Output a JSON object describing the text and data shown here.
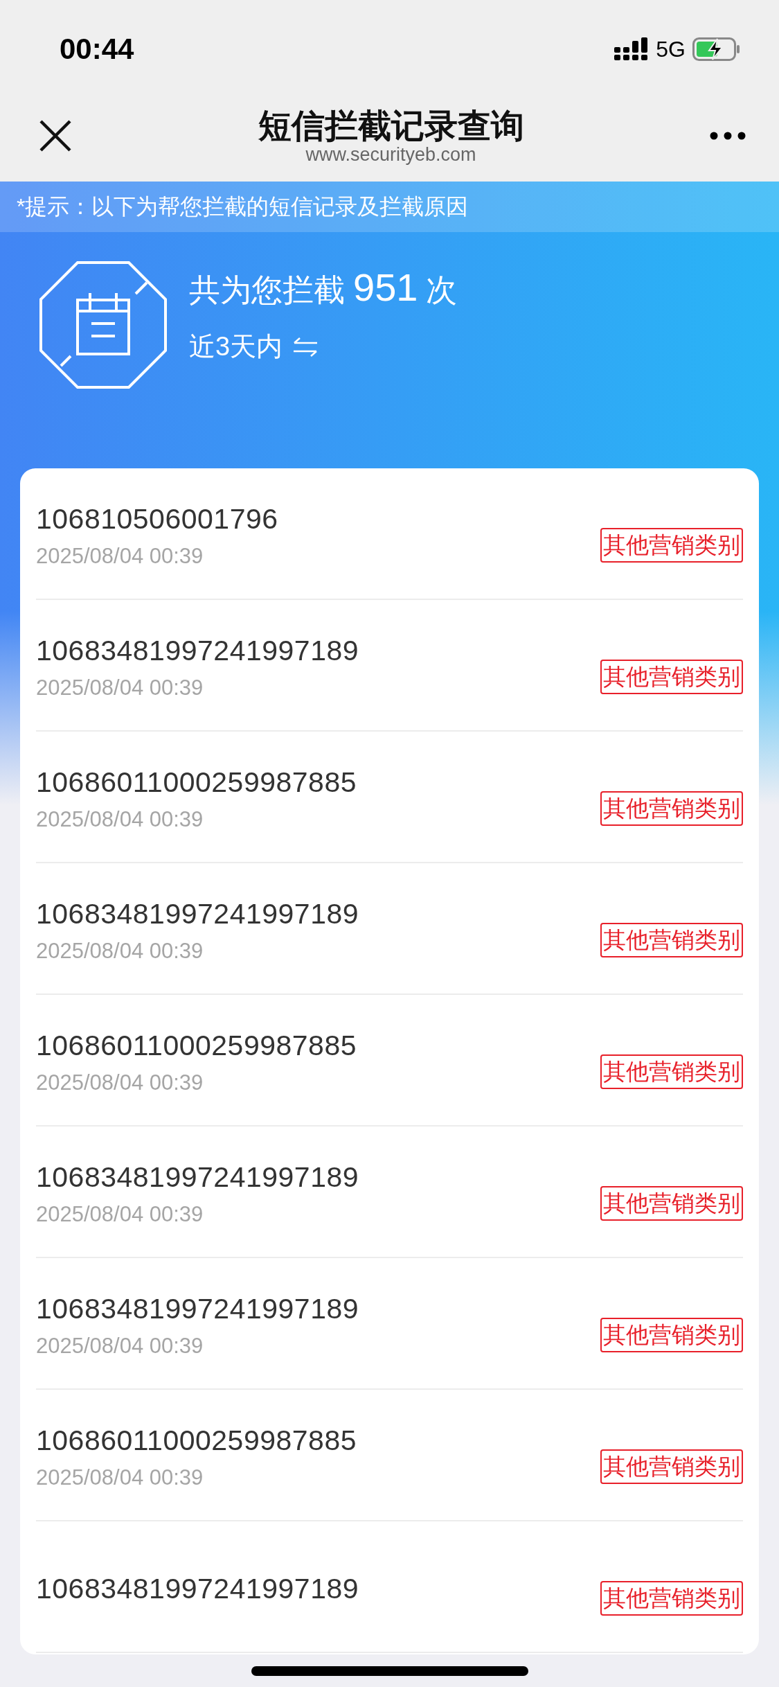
{
  "status_bar": {
    "time": "00:44",
    "network": "5G"
  },
  "nav": {
    "title": "短信拦截记录查询",
    "subtitle": "www.securityeb.com"
  },
  "hint": "*提示：以下为帮您拦截的短信记录及拦截原因",
  "summary": {
    "prefix": "共为您拦截",
    "count": "951",
    "suffix": "次",
    "period": "近3天内"
  },
  "records": [
    {
      "number": "106810506001796",
      "date": "2025/08/04 00:39",
      "tag": "其他营销类别"
    },
    {
      "number": "10683481997241997189",
      "date": "2025/08/04 00:39",
      "tag": "其他营销类别"
    },
    {
      "number": "10686011000259987885",
      "date": "2025/08/04 00:39",
      "tag": "其他营销类别"
    },
    {
      "number": "10683481997241997189",
      "date": "2025/08/04 00:39",
      "tag": "其他营销类别"
    },
    {
      "number": "10686011000259987885",
      "date": "2025/08/04 00:39",
      "tag": "其他营销类别"
    },
    {
      "number": "10683481997241997189",
      "date": "2025/08/04 00:39",
      "tag": "其他营销类别"
    },
    {
      "number": "10683481997241997189",
      "date": "2025/08/04 00:39",
      "tag": "其他营销类别"
    },
    {
      "number": "10686011000259987885",
      "date": "2025/08/04 00:39",
      "tag": "其他营销类别"
    },
    {
      "number": "10683481997241997189",
      "tag": "其他营销类别"
    }
  ]
}
